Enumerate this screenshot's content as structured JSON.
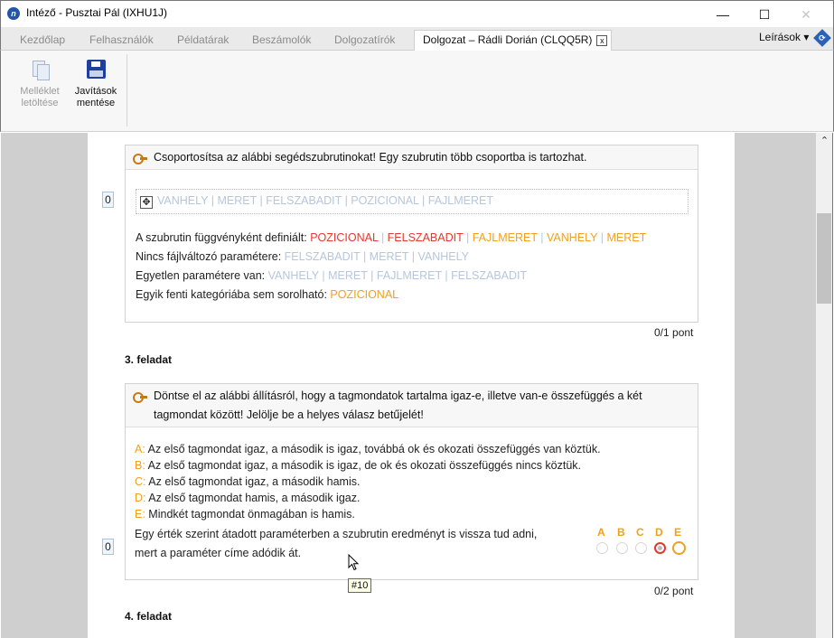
{
  "window": {
    "title": "Intéző - Pusztai Pál (IXHU1J)",
    "app_icon": "hu-app-icon",
    "controls": [
      "minimize",
      "maximize",
      "close"
    ]
  },
  "tabs": [
    {
      "label": "Kezdőlap",
      "active": false
    },
    {
      "label": "Felhasználók",
      "active": false
    },
    {
      "label": "Példatárak",
      "active": false
    },
    {
      "label": "Beszámolók",
      "active": false
    },
    {
      "label": "Dolgozatírók",
      "active": false
    },
    {
      "label": "Dolgozat – Rádli Dorián (CLQQ5R)",
      "active": true,
      "close": "x"
    }
  ],
  "descriptions_menu": {
    "label": "Leírások ▾"
  },
  "toolbar": {
    "download": {
      "line1": "Melléklet",
      "line2": "letöltése",
      "enabled": false
    },
    "save": {
      "line1": "Javítások",
      "line2": "mentése",
      "enabled": true
    }
  },
  "task2": {
    "score": "0",
    "question": "Csoportosítsa az alábbi segédszubrutinokat! Egy szubrutin több csoportba is tartozhat.",
    "items": [
      "VANHELY",
      "MERET",
      "FELSZABADIT",
      "POZICIONAL",
      "FAJLMERET"
    ],
    "categories": [
      {
        "label": "A szubrutin függvényként definiált:",
        "values": [
          {
            "text": "POZICIONAL",
            "color": "#e03a2e"
          },
          {
            "text": "FELSZABADIT",
            "color": "#e03a2e"
          },
          {
            "text": "FAJLMERET",
            "color": "#f0a020"
          },
          {
            "text": "VANHELY",
            "color": "#f0a020"
          },
          {
            "text": "MERET",
            "color": "#f0a020"
          }
        ]
      },
      {
        "label": "Nincs fájlváltozó paramétere:",
        "values": [
          {
            "text": "FELSZABADIT",
            "color": "#b6c6dc"
          },
          {
            "text": "MERET",
            "color": "#b6c6dc"
          },
          {
            "text": "VANHELY",
            "color": "#b6c6dc"
          }
        ]
      },
      {
        "label": "Egyetlen paramétere van:",
        "values": [
          {
            "text": "VANHELY",
            "color": "#b6c6dc"
          },
          {
            "text": "MERET",
            "color": "#b6c6dc"
          },
          {
            "text": "FAJLMERET",
            "color": "#b6c6dc"
          },
          {
            "text": "FELSZABADIT",
            "color": "#b6c6dc"
          }
        ]
      },
      {
        "label": "Egyik fenti kategóriába sem sorolható:",
        "values": [
          {
            "text": "POZICIONAL",
            "color": "#f0a020"
          }
        ]
      }
    ],
    "points": "0/1 pont"
  },
  "task3": {
    "title": "3. feladat",
    "score": "0",
    "question_line1": "Döntse el az alábbi állításról, hogy a tagmondatok tartalma igaz-e, illetve van-e összefüggés a két",
    "question_line2": "tagmondat között! Jelölje be a helyes válasz betűjelét!",
    "options": [
      {
        "letter": "A:",
        "text": "Az első tagmondat igaz, a második is igaz, továbbá ok és okozati összefüggés van köztük."
      },
      {
        "letter": "B:",
        "text": "Az első tagmondat igaz, a második is igaz, de ok és okozati összefüggés nincs köztük."
      },
      {
        "letter": "C:",
        "text": "Az első tagmondat igaz, a második hamis."
      },
      {
        "letter": "D:",
        "text": "Az első tagmondat hamis, a második igaz."
      },
      {
        "letter": "E:",
        "text": "Mindkét tagmondat önmagában is hamis."
      }
    ],
    "statement_line1": "Egy érték szerint átadott paraméterben a szubrutin eredményt is vissza tud adni,",
    "statement_line2": "mert a paraméter címe adódik át.",
    "answer_letters": [
      "A",
      "B",
      "C",
      "D",
      "E"
    ],
    "selected": "D",
    "correct": "E",
    "points": "0/2 pont",
    "tooltip": "#10"
  },
  "task4": {
    "title": "4. feladat"
  },
  "colors": {
    "wrong": "#e03a2e",
    "correct": "#f0a020",
    "unused": "#b6c6dc"
  }
}
